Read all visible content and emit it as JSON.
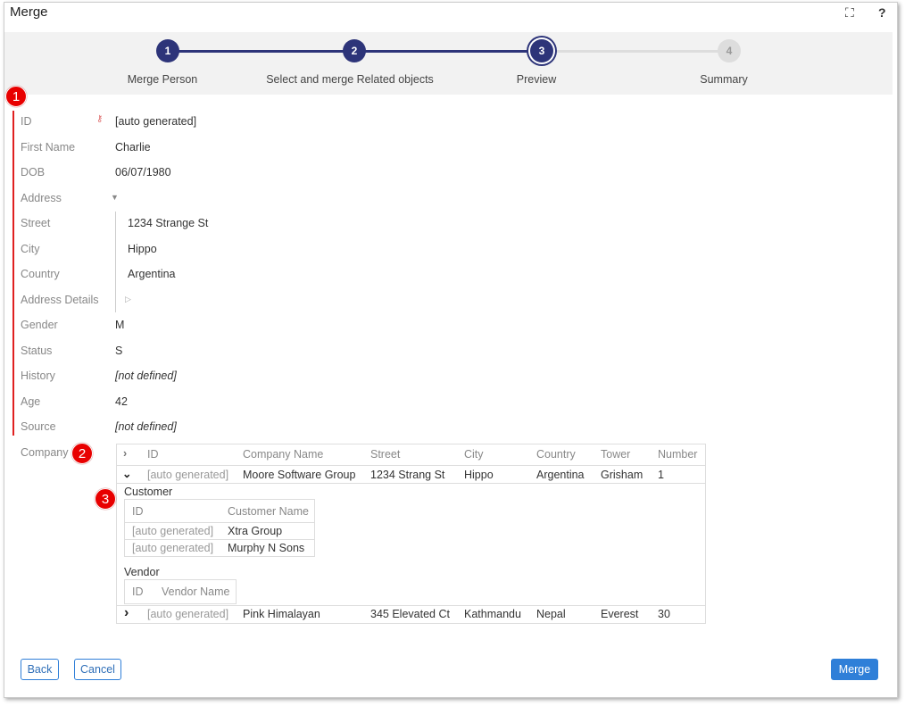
{
  "window": {
    "title": "Merge",
    "fullscreen_icon": "fullscreen-icon",
    "help_icon": "?"
  },
  "steps": [
    {
      "num": "1",
      "label": "Merge Person"
    },
    {
      "num": "2",
      "label": "Select and merge Related objects"
    },
    {
      "num": "3",
      "label": "Preview"
    },
    {
      "num": "4",
      "label": "Summary"
    }
  ],
  "current_step": 3,
  "fields": {
    "id": {
      "label": "ID",
      "value": "[auto generated]"
    },
    "first_name": {
      "label": "First Name",
      "value": "Charlie"
    },
    "dob": {
      "label": "DOB",
      "value": "06/07/1980"
    },
    "address": {
      "label": "Address"
    },
    "street": {
      "label": "Street",
      "value": "1234 Strange St"
    },
    "city": {
      "label": "City",
      "value": "Hippo"
    },
    "country": {
      "label": "Country",
      "value": "Argentina"
    },
    "address_details": {
      "label": "Address Details"
    },
    "gender": {
      "label": "Gender",
      "value": "M"
    },
    "status": {
      "label": "Status",
      "value": "S"
    },
    "history": {
      "label": "History",
      "value": "[not defined]"
    },
    "age": {
      "label": "Age",
      "value": "42"
    },
    "source": {
      "label": "Source",
      "value": "[not defined]"
    },
    "company": {
      "label": "Company"
    }
  },
  "company_table": {
    "headers": [
      "ID",
      "Company Name",
      "Street",
      "City",
      "Country",
      "Tower",
      "Number"
    ],
    "rows": [
      [
        "[auto generated]",
        "Moore Software Group",
        "1234 Strang St",
        "Hippo",
        "Argentina",
        "Grisham",
        "1"
      ],
      [
        "[auto generated]",
        "Pink Himalayan",
        "345 Elevated Ct",
        "Kathmandu",
        "Nepal",
        "Everest",
        "30"
      ]
    ],
    "customer": {
      "title": "Customer",
      "headers": [
        "ID",
        "Customer Name"
      ],
      "rows": [
        [
          "[auto generated]",
          "Xtra Group"
        ],
        [
          "[auto generated]",
          "Murphy N Sons"
        ]
      ]
    },
    "vendor": {
      "title": "Vendor",
      "headers": [
        "ID",
        "Vendor Name"
      ]
    }
  },
  "badges": [
    "1",
    "2",
    "3"
  ],
  "buttons": {
    "back": "Back",
    "cancel": "Cancel",
    "merge": "Merge"
  },
  "colors": {
    "step_active": "#2d3479",
    "primary": "#2f7fd8",
    "badge": "#e80000"
  }
}
